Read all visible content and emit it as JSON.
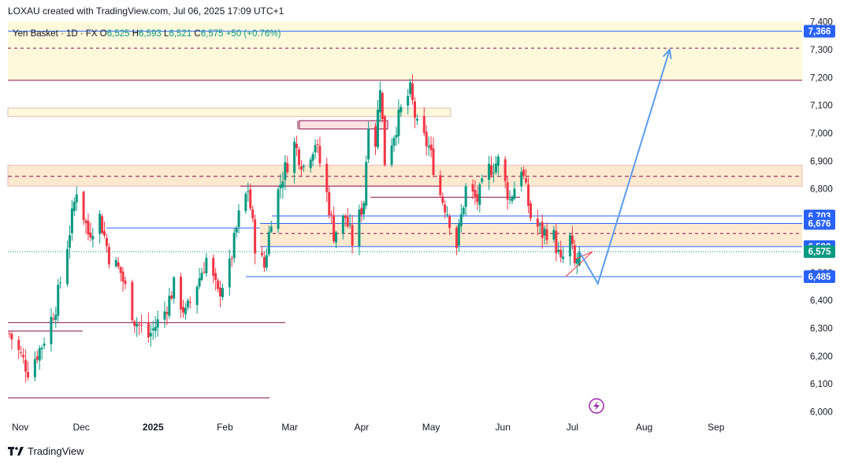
{
  "header": {
    "created_by": "LOXAU created with TradingView.com, Jul 06, 2025 17:09 UTC+1"
  },
  "footer": {
    "brand": "TradingView"
  },
  "colors": {
    "up": "#089981",
    "down": "#f23645",
    "blue_line": "#2962ff",
    "maroon_line": "#880e4f",
    "zone_fill": "#fde9cf",
    "light_zone_fill": "#fff9db",
    "projection": "#5b9cf0",
    "price_badge": "#2962ff",
    "last_price_badge": "#089981"
  },
  "chart_data": {
    "type": "candlestick",
    "legend": {
      "symbol": "Yen Basket · 1D · FX",
      "open_label": "O",
      "open": "6,525",
      "high_label": "H",
      "high": "6,593",
      "low_label": "L",
      "low": "6,521",
      "close_label": "C",
      "close": "6,575",
      "change": "+50 (+0.76%)"
    },
    "ylim": [
      6000,
      7400
    ],
    "y_ticks": [
      "6,000",
      "6,100",
      "6,200",
      "6,300",
      "6,400",
      "6,500",
      "6,600",
      "6,700",
      "6,800",
      "6,900",
      "7,000",
      "7,100",
      "7,200",
      "7,300",
      "7,400"
    ],
    "y_tick_values": [
      6000,
      6100,
      6200,
      6300,
      6400,
      6500,
      6600,
      6700,
      6800,
      6900,
      7000,
      7100,
      7200,
      7300,
      7400
    ],
    "x_labels": [
      {
        "label": "Nov",
        "date": "2024-11-01",
        "bold": false
      },
      {
        "label": "Dec",
        "date": "2024-12-01",
        "bold": false
      },
      {
        "label": "2025",
        "date": "2025-01-01",
        "bold": true
      },
      {
        "label": "Feb",
        "date": "2025-02-01",
        "bold": false
      },
      {
        "label": "Mar",
        "date": "2025-03-01",
        "bold": false
      },
      {
        "label": "Apr",
        "date": "2025-04-01",
        "bold": false
      },
      {
        "label": "May",
        "date": "2025-05-01",
        "bold": false
      },
      {
        "label": "Jun",
        "date": "2025-06-01",
        "bold": false
      },
      {
        "label": "Jul",
        "date": "2025-07-01",
        "bold": false
      },
      {
        "label": "Aug",
        "date": "2025-08-01",
        "bold": false
      },
      {
        "label": "Sep",
        "date": "2025-09-01",
        "bold": false
      }
    ],
    "price_labels": [
      {
        "value": 7366,
        "text": "7,366",
        "kind": "level"
      },
      {
        "value": 6703,
        "text": "6,703",
        "kind": "level"
      },
      {
        "value": 6676,
        "text": "6,676",
        "kind": "level"
      },
      {
        "value": 6593,
        "text": "6,593",
        "kind": "level"
      },
      {
        "value": 6575,
        "text": "6,575",
        "kind": "last"
      },
      {
        "value": 6485,
        "text": "6,485",
        "kind": "level"
      }
    ],
    "trend_points": [
      [
        "2024-10-31",
        6280
      ],
      [
        "2024-11-05",
        6200
      ],
      [
        "2024-11-08",
        6150
      ],
      [
        "2024-11-14",
        6240
      ],
      [
        "2024-11-20",
        6380
      ],
      [
        "2024-11-25",
        6600
      ],
      [
        "2024-11-29",
        6800
      ],
      [
        "2024-12-04",
        6640
      ],
      [
        "2024-12-09",
        6700
      ],
      [
        "2024-12-13",
        6560
      ],
      [
        "2024-12-18",
        6500
      ],
      [
        "2024-12-24",
        6330
      ],
      [
        "2024-12-30",
        6270
      ],
      [
        "2025-01-06",
        6360
      ],
      [
        "2025-01-10",
        6450
      ],
      [
        "2025-01-15",
        6350
      ],
      [
        "2025-01-20",
        6460
      ],
      [
        "2025-01-24",
        6550
      ],
      [
        "2025-01-29",
        6420
      ],
      [
        "2025-02-03",
        6520
      ],
      [
        "2025-02-07",
        6700
      ],
      [
        "2025-02-11",
        6800
      ],
      [
        "2025-02-14",
        6600
      ],
      [
        "2025-02-18",
        6520
      ],
      [
        "2025-02-21",
        6700
      ],
      [
        "2025-02-26",
        6850
      ],
      [
        "2025-03-03",
        6960
      ],
      [
        "2025-03-07",
        6880
      ],
      [
        "2025-03-12",
        6970
      ],
      [
        "2025-03-17",
        6780
      ],
      [
        "2025-03-20",
        6640
      ],
      [
        "2025-03-25",
        6700
      ],
      [
        "2025-03-28",
        6610
      ],
      [
        "2025-04-02",
        6760
      ],
      [
        "2025-04-04",
        7050
      ],
      [
        "2025-04-07",
        6970
      ],
      [
        "2025-04-09",
        7180
      ],
      [
        "2025-04-11",
        6900
      ],
      [
        "2025-04-15",
        7000
      ],
      [
        "2025-04-18",
        7080
      ],
      [
        "2025-04-22",
        7150
      ],
      [
        "2025-04-25",
        7020
      ],
      [
        "2025-04-30",
        6950
      ],
      [
        "2025-05-05",
        6780
      ],
      [
        "2025-05-08",
        6720
      ],
      [
        "2025-05-12",
        6600
      ],
      [
        "2025-05-16",
        6800
      ],
      [
        "2025-05-21",
        6760
      ],
      [
        "2025-05-26",
        6870
      ],
      [
        "2025-05-30",
        6900
      ],
      [
        "2025-06-04",
        6760
      ],
      [
        "2025-06-09",
        6880
      ],
      [
        "2025-06-13",
        6700
      ],
      [
        "2025-06-18",
        6640
      ],
      [
        "2025-06-22",
        6660
      ],
      [
        "2025-06-26",
        6530
      ],
      [
        "2025-06-30",
        6620
      ],
      [
        "2025-07-02",
        6525
      ],
      [
        "2025-07-04",
        6575
      ]
    ],
    "projection": [
      {
        "date": "2025-07-04",
        "value": 6575
      },
      {
        "date": "2025-07-12",
        "value": 6460
      },
      {
        "date": "2025-08-12",
        "value": 7300
      }
    ]
  }
}
